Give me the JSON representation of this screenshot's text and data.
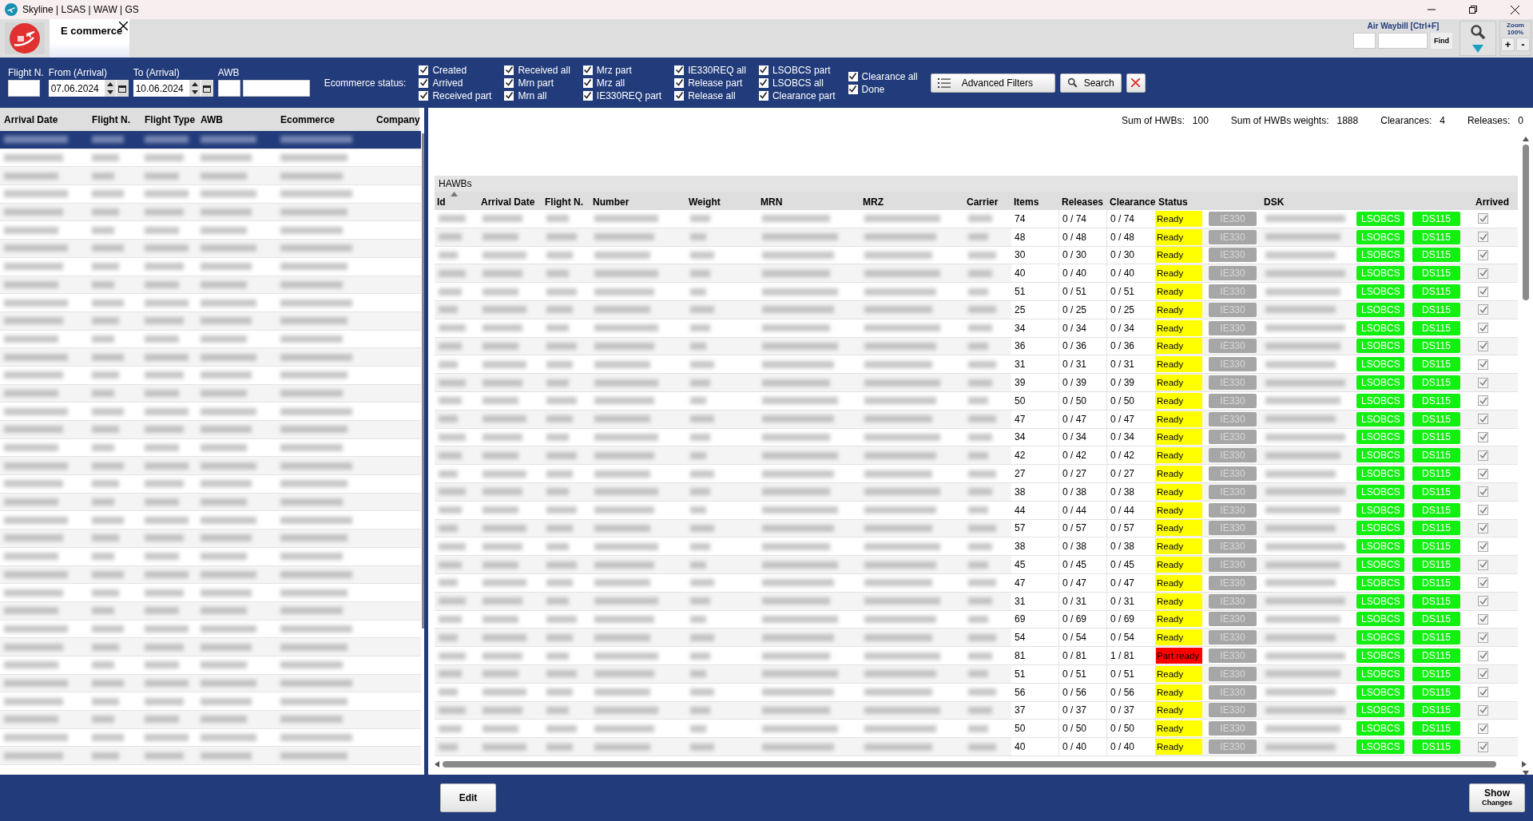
{
  "window": {
    "title": "Skyline | LSAS | WAW | GS"
  },
  "tabs": [
    {
      "label": "E commerce",
      "selected": true
    }
  ],
  "awb_search": {
    "label": "Air Waybill [Ctrl+F]",
    "find_button": "Find"
  },
  "zoom": {
    "label": "Zoom",
    "value": "100%",
    "plus": "+",
    "minus": "-"
  },
  "filters": {
    "flight": {
      "label": "Flight N."
    },
    "from": {
      "label": "From (Arrival)",
      "value": "07.06.2024"
    },
    "to": {
      "label": "To (Arrival)",
      "value": "10.06.2024"
    },
    "awb": {
      "label": "AWB"
    },
    "status_label": "Ecommerce status:",
    "status_groups": [
      [
        {
          "label": "Created",
          "checked": true
        },
        {
          "label": "Arrived",
          "checked": true
        },
        {
          "label": "Received part",
          "checked": true
        }
      ],
      [
        {
          "label": "Received all",
          "checked": true
        },
        {
          "label": "Mrn part",
          "checked": true
        },
        {
          "label": "Mrn all",
          "checked": true
        }
      ],
      [
        {
          "label": "Mrz part",
          "checked": true
        },
        {
          "label": "Mrz all",
          "checked": true
        },
        {
          "label": "IE330REQ part",
          "checked": true
        }
      ],
      [
        {
          "label": "IE330REQ all",
          "checked": true
        },
        {
          "label": "Release part",
          "checked": true
        },
        {
          "label": "Release all",
          "checked": true
        }
      ],
      [
        {
          "label": "LSOBCS part",
          "checked": true
        },
        {
          "label": "LSOBCS all",
          "checked": true
        },
        {
          "label": "Clearance part",
          "checked": true
        }
      ],
      [
        {
          "label": "Clearance all",
          "checked": true
        },
        {
          "label": "Done",
          "checked": true
        }
      ]
    ],
    "advanced_button": "Advanced Filters",
    "search_button": "Search"
  },
  "left_table": {
    "columns": [
      "Arrival Date",
      "Flight N.",
      "Flight Type",
      "AWB",
      "Ecommerce",
      "Company"
    ],
    "rows": [
      {
        "selected": true
      },
      {
        "selected": false
      },
      {
        "selected": false
      },
      {
        "selected": false
      },
      {
        "selected": false
      },
      {
        "selected": false
      },
      {
        "selected": false
      },
      {
        "selected": false
      },
      {
        "selected": false
      },
      {
        "selected": false
      },
      {
        "selected": false
      },
      {
        "selected": false
      },
      {
        "selected": false
      },
      {
        "selected": false
      },
      {
        "selected": false
      },
      {
        "selected": false
      },
      {
        "selected": false
      },
      {
        "selected": false
      },
      {
        "selected": false
      },
      {
        "selected": false
      },
      {
        "selected": false
      },
      {
        "selected": false
      },
      {
        "selected": false
      },
      {
        "selected": false
      },
      {
        "selected": false
      },
      {
        "selected": false
      },
      {
        "selected": false
      },
      {
        "selected": false
      },
      {
        "selected": false
      },
      {
        "selected": false
      },
      {
        "selected": false
      },
      {
        "selected": false
      },
      {
        "selected": false
      },
      {
        "selected": false
      },
      {
        "selected": false
      }
    ]
  },
  "summary": [
    {
      "label": "Sum of HWBs:",
      "value": "100"
    },
    {
      "label": "Sum of HWBs weights:",
      "value": "1888"
    },
    {
      "label": "Clearances:",
      "value": "4"
    },
    {
      "label": "Releases:",
      "value": "0"
    }
  ],
  "hawbs": {
    "title": "HAWBs",
    "columns": [
      "Id",
      "Arrival Date",
      "Flight N.",
      "Number",
      "Weight",
      "MRN",
      "MRZ",
      "Carrier",
      "Items",
      "Releases",
      "Clearance",
      "Status",
      "DSK",
      "Arrived"
    ],
    "rows": [
      {
        "items": "74",
        "releases": "0 / 74",
        "clearances": "0 / 74",
        "status": "Ready",
        "color": "#ffff00",
        "ie": "IE330",
        "lsobcs": "LSOBCS",
        "ds": "DS115",
        "arrived": true
      },
      {
        "items": "48",
        "releases": "0 / 48",
        "clearances": "0 / 48",
        "status": "Ready",
        "color": "#ffff00",
        "ie": "IE330",
        "lsobcs": "LSOBCS",
        "ds": "DS115",
        "arrived": true
      },
      {
        "items": "30",
        "releases": "0 / 30",
        "clearances": "0 / 30",
        "status": "Ready",
        "color": "#ffff00",
        "ie": "IE330",
        "lsobcs": "LSOBCS",
        "ds": "DS115",
        "arrived": true
      },
      {
        "items": "40",
        "releases": "0 / 40",
        "clearances": "0 / 40",
        "status": "Ready",
        "color": "#ffff00",
        "ie": "IE330",
        "lsobcs": "LSOBCS",
        "ds": "DS115",
        "arrived": true
      },
      {
        "items": "51",
        "releases": "0 / 51",
        "clearances": "0 / 51",
        "status": "Ready",
        "color": "#ffff00",
        "ie": "IE330",
        "lsobcs": "LSOBCS",
        "ds": "DS115",
        "arrived": true
      },
      {
        "items": "25",
        "releases": "0 / 25",
        "clearances": "0 / 25",
        "status": "Ready",
        "color": "#ffff00",
        "ie": "IE330",
        "lsobcs": "LSOBCS",
        "ds": "DS115",
        "arrived": true
      },
      {
        "items": "34",
        "releases": "0 / 34",
        "clearances": "0 / 34",
        "status": "Ready",
        "color": "#ffff00",
        "ie": "IE330",
        "lsobcs": "LSOBCS",
        "ds": "DS115",
        "arrived": true
      },
      {
        "items": "36",
        "releases": "0 / 36",
        "clearances": "0 / 36",
        "status": "Ready",
        "color": "#ffff00",
        "ie": "IE330",
        "lsobcs": "LSOBCS",
        "ds": "DS115",
        "arrived": true
      },
      {
        "items": "31",
        "releases": "0 / 31",
        "clearances": "0 / 31",
        "status": "Ready",
        "color": "#ffff00",
        "ie": "IE330",
        "lsobcs": "LSOBCS",
        "ds": "DS115",
        "arrived": true
      },
      {
        "items": "39",
        "releases": "0 / 39",
        "clearances": "0 / 39",
        "status": "Ready",
        "color": "#ffff00",
        "ie": "IE330",
        "lsobcs": "LSOBCS",
        "ds": "DS115",
        "arrived": true
      },
      {
        "items": "50",
        "releases": "0 / 50",
        "clearances": "0 / 50",
        "status": "Ready",
        "color": "#ffff00",
        "ie": "IE330",
        "lsobcs": "LSOBCS",
        "ds": "DS115",
        "arrived": true
      },
      {
        "items": "47",
        "releases": "0 / 47",
        "clearances": "0 / 47",
        "status": "Ready",
        "color": "#ffff00",
        "ie": "IE330",
        "lsobcs": "LSOBCS",
        "ds": "DS115",
        "arrived": true
      },
      {
        "items": "34",
        "releases": "0 / 34",
        "clearances": "0 / 34",
        "status": "Ready",
        "color": "#ffff00",
        "ie": "IE330",
        "lsobcs": "LSOBCS",
        "ds": "DS115",
        "arrived": true
      },
      {
        "items": "42",
        "releases": "0 / 42",
        "clearances": "0 / 42",
        "status": "Ready",
        "color": "#ffff00",
        "ie": "IE330",
        "lsobcs": "LSOBCS",
        "ds": "DS115",
        "arrived": true
      },
      {
        "items": "27",
        "releases": "0 / 27",
        "clearances": "0 / 27",
        "status": "Ready",
        "color": "#ffff00",
        "ie": "IE330",
        "lsobcs": "LSOBCS",
        "ds": "DS115",
        "arrived": true
      },
      {
        "items": "38",
        "releases": "0 / 38",
        "clearances": "0 / 38",
        "status": "Ready",
        "color": "#ffff00",
        "ie": "IE330",
        "lsobcs": "LSOBCS",
        "ds": "DS115",
        "arrived": true
      },
      {
        "items": "44",
        "releases": "0 / 44",
        "clearances": "0 / 44",
        "status": "Ready",
        "color": "#ffff00",
        "ie": "IE330",
        "lsobcs": "LSOBCS",
        "ds": "DS115",
        "arrived": true
      },
      {
        "items": "57",
        "releases": "0 / 57",
        "clearances": "0 / 57",
        "status": "Ready",
        "color": "#ffff00",
        "ie": "IE330",
        "lsobcs": "LSOBCS",
        "ds": "DS115",
        "arrived": true
      },
      {
        "items": "38",
        "releases": "0 / 38",
        "clearances": "0 / 38",
        "status": "Ready",
        "color": "#ffff00",
        "ie": "IE330",
        "lsobcs": "LSOBCS",
        "ds": "DS115",
        "arrived": true
      },
      {
        "items": "45",
        "releases": "0 / 45",
        "clearances": "0 / 45",
        "status": "Ready",
        "color": "#ffff00",
        "ie": "IE330",
        "lsobcs": "LSOBCS",
        "ds": "DS115",
        "arrived": true
      },
      {
        "items": "47",
        "releases": "0 / 47",
        "clearances": "0 / 47",
        "status": "Ready",
        "color": "#ffff00",
        "ie": "IE330",
        "lsobcs": "LSOBCS",
        "ds": "DS115",
        "arrived": true
      },
      {
        "items": "31",
        "releases": "0 / 31",
        "clearances": "0 / 31",
        "status": "Ready",
        "color": "#ffff00",
        "ie": "IE330",
        "lsobcs": "LSOBCS",
        "ds": "DS115",
        "arrived": true
      },
      {
        "items": "69",
        "releases": "0 / 69",
        "clearances": "0 / 69",
        "status": "Ready",
        "color": "#ffff00",
        "ie": "IE330",
        "lsobcs": "LSOBCS",
        "ds": "DS115",
        "arrived": true
      },
      {
        "items": "54",
        "releases": "0 / 54",
        "clearances": "0 / 54",
        "status": "Ready",
        "color": "#ffff00",
        "ie": "IE330",
        "lsobcs": "LSOBCS",
        "ds": "DS115",
        "arrived": true
      },
      {
        "items": "81",
        "releases": "0 / 81",
        "clearances": "1 / 81",
        "status": "Part ready",
        "color": "#ff0000",
        "ie": "IE330",
        "lsobcs": "LSOBCS",
        "ds": "DS115",
        "arrived": true
      },
      {
        "items": "51",
        "releases": "0 / 51",
        "clearances": "0 / 51",
        "status": "Ready",
        "color": "#ffff00",
        "ie": "IE330",
        "lsobcs": "LSOBCS",
        "ds": "DS115",
        "arrived": true
      },
      {
        "items": "56",
        "releases": "0 / 56",
        "clearances": "0 / 56",
        "status": "Ready",
        "color": "#ffff00",
        "ie": "IE330",
        "lsobcs": "LSOBCS",
        "ds": "DS115",
        "arrived": true
      },
      {
        "items": "37",
        "releases": "0 / 37",
        "clearances": "0 / 37",
        "status": "Ready",
        "color": "#ffff00",
        "ie": "IE330",
        "lsobcs": "LSOBCS",
        "ds": "DS115",
        "arrived": true
      },
      {
        "items": "50",
        "releases": "0 / 50",
        "clearances": "0 / 50",
        "status": "Ready",
        "color": "#ffff00",
        "ie": "IE330",
        "lsobcs": "LSOBCS",
        "ds": "DS115",
        "arrived": true
      },
      {
        "items": "40",
        "releases": "0 / 40",
        "clearances": "0 / 40",
        "status": "Ready",
        "color": "#ffff00",
        "ie": "IE330",
        "lsobcs": "LSOBCS",
        "ds": "DS115",
        "arrived": true
      }
    ]
  },
  "footer": {
    "edit_button": "Edit",
    "show_button": "Show",
    "show_sub": "Changes"
  }
}
